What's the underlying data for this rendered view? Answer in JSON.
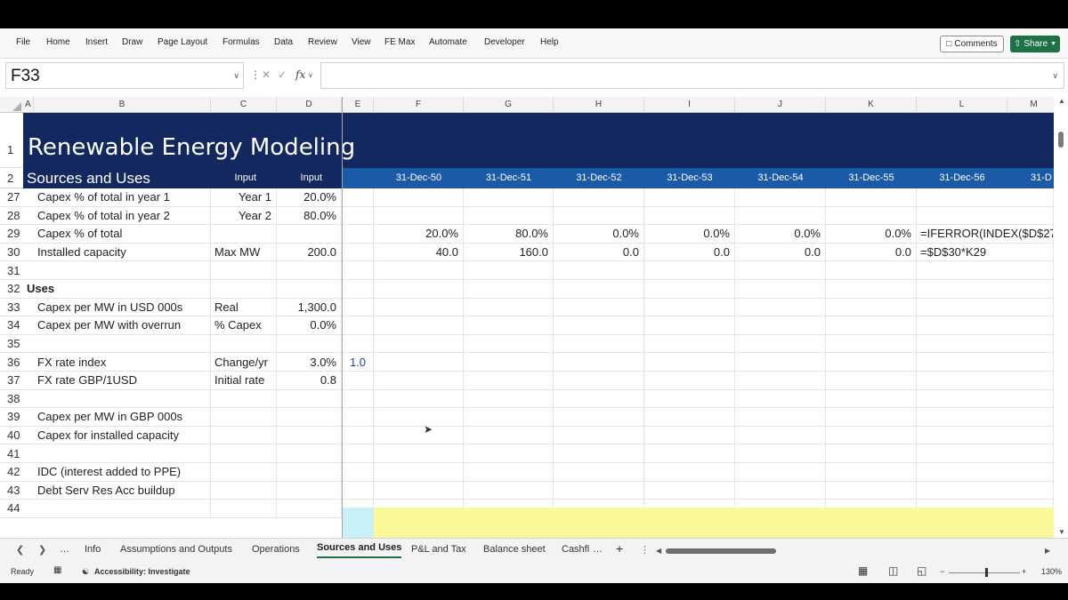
{
  "ribbon": {
    "menu": [
      "File",
      "Home",
      "Insert",
      "Draw",
      "Page Layout",
      "Formulas",
      "Data",
      "Review",
      "View",
      "FE Max",
      "Automate",
      "Developer",
      "Help"
    ],
    "comments_label": "Comments",
    "share_label": "Share"
  },
  "formula_bar": {
    "name_box": "F33",
    "fx_label": "fx",
    "formula": ""
  },
  "columns": [
    "A",
    "B",
    "C",
    "D",
    "E",
    "F",
    "G",
    "H",
    "I",
    "J",
    "K",
    "L",
    "M"
  ],
  "sheet": {
    "title": "Renewable Energy Modeling",
    "section": "Sources and Uses",
    "input1": "Input",
    "input2": "Input",
    "dates": [
      "31-Dec-50",
      "31-Dec-51",
      "31-Dec-52",
      "31-Dec-53",
      "31-Dec-54",
      "31-Dec-55",
      "31-Dec-56",
      "31-D"
    ],
    "rows": [
      {
        "num": "27",
        "b": "Capex % of total in year 1",
        "c": "Year 1",
        "c_align": "r",
        "d": "20.0%",
        "e": "",
        "vals": [],
        "l": ""
      },
      {
        "num": "28",
        "b": "Capex % of total in year 2",
        "c": "Year 2",
        "c_align": "r",
        "d": "80.0%",
        "e": "",
        "vals": [],
        "l": ""
      },
      {
        "num": "29",
        "b": "Capex % of total",
        "c": "",
        "c_align": "l",
        "d": "",
        "e": "",
        "vals": [
          "20.0%",
          "80.0%",
          "0.0%",
          "0.0%",
          "0.0%",
          "0.0%"
        ],
        "l": "=IFERROR(INDEX($D$27:"
      },
      {
        "num": "30",
        "b": "Installed capacity",
        "c": "Max MW",
        "c_align": "l",
        "d": "200.0",
        "e": "",
        "vals": [
          "40.0",
          "160.0",
          "0.0",
          "0.0",
          "0.0",
          "0.0"
        ],
        "l": "=$D$30*K29"
      },
      {
        "num": "31",
        "b": "",
        "c": "",
        "c_align": "l",
        "d": "",
        "e": "",
        "vals": [],
        "l": ""
      },
      {
        "num": "32",
        "a": "Uses",
        "b": "",
        "c": "",
        "c_align": "l",
        "d": "",
        "e": "",
        "vals": [],
        "l": ""
      },
      {
        "num": "33",
        "b": "Capex per MW  in USD 000s",
        "c": "Real",
        "c_align": "l",
        "d": "1,300.0",
        "e": "",
        "vals": [],
        "l": ""
      },
      {
        "num": "34",
        "b": "Capex per MW with overrun",
        "c": "% Capex",
        "c_align": "l",
        "d": "0.0%",
        "e": "",
        "vals": [],
        "l": ""
      },
      {
        "num": "35",
        "b": "",
        "c": "",
        "c_align": "l",
        "d": "",
        "e": "",
        "vals": [],
        "l": ""
      },
      {
        "num": "36",
        "b": "FX rate index",
        "c": "Change/yr",
        "c_align": "l",
        "d": "3.0%",
        "e": "1.0",
        "vals": [],
        "l": ""
      },
      {
        "num": "37",
        "b": "FX rate GBP/1USD",
        "c": "Initial rate",
        "c_align": "l",
        "d": "0.8",
        "e": "",
        "vals": [],
        "l": ""
      },
      {
        "num": "38",
        "b": "",
        "c": "",
        "c_align": "l",
        "d": "",
        "e": "",
        "vals": [],
        "l": ""
      },
      {
        "num": "39",
        "b": "Capex per MW in GBP 000s",
        "c": "",
        "c_align": "l",
        "d": "",
        "e": "",
        "vals": [],
        "l": ""
      },
      {
        "num": "40",
        "b": "Capex for installed capacity",
        "c": "",
        "c_align": "l",
        "d": "",
        "e": "",
        "vals": [],
        "l": ""
      },
      {
        "num": "41",
        "b": "",
        "c": "",
        "c_align": "l",
        "d": "",
        "e": "",
        "vals": [],
        "l": ""
      },
      {
        "num": "42",
        "b": "IDC (interest added to PPE)",
        "c": "",
        "c_align": "l",
        "d": "",
        "e": "",
        "vals": [],
        "l": ""
      },
      {
        "num": "43",
        "b": "Debt Serv Res Acc buildup",
        "c": "",
        "c_align": "l",
        "d": "",
        "e": "",
        "vals": [],
        "l": ""
      },
      {
        "num": "44",
        "b": "",
        "c": "",
        "c_align": "l",
        "d": "",
        "e": "",
        "vals": [],
        "l": ""
      }
    ]
  },
  "tabs": {
    "more": "…",
    "items": [
      "Info",
      "Assumptions and Outputs",
      "Operations",
      "Sources and Uses",
      "P&L and Tax",
      "Balance sheet",
      "Cashfl"
    ],
    "active": "Sources and Uses",
    "add": "+"
  },
  "status": {
    "ready": "Ready",
    "accessibility": "Accessibility: Investigate",
    "zoom": "130%",
    "zoom_minus": "−",
    "zoom_plus": "+"
  }
}
